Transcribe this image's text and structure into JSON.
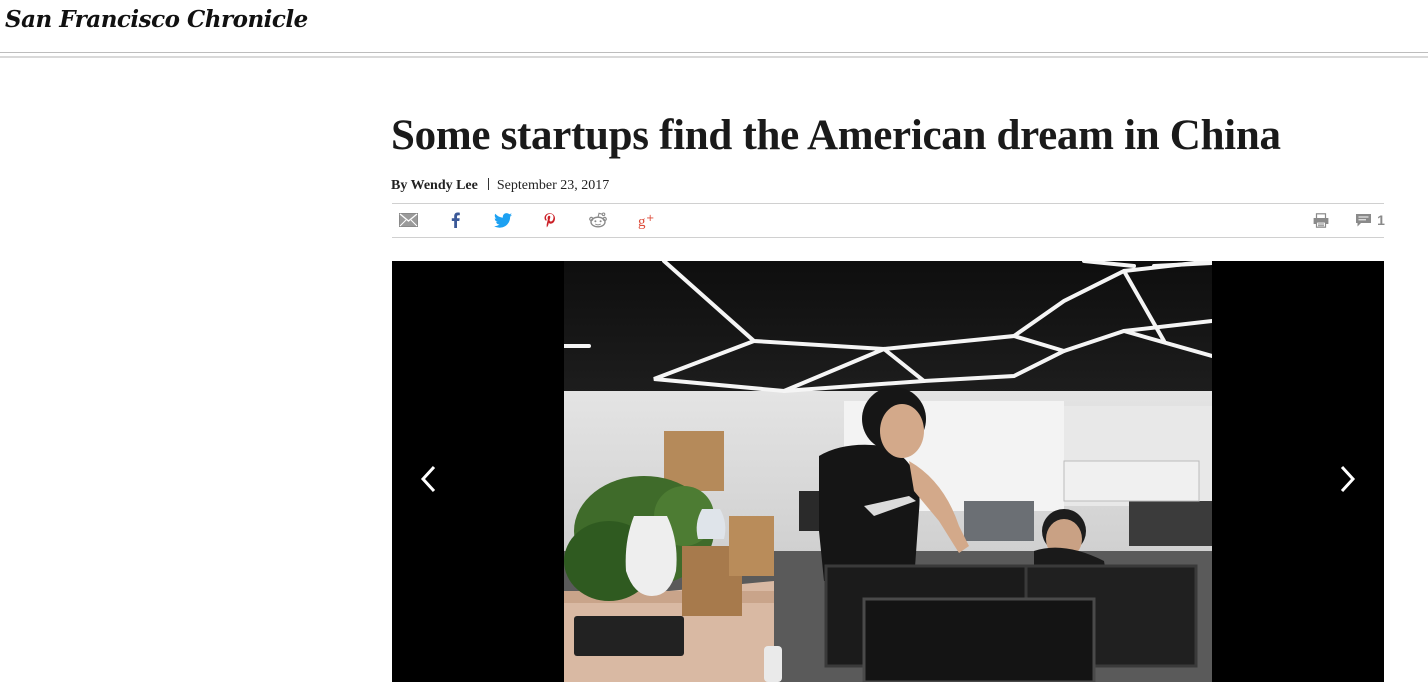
{
  "masthead": {
    "logo_text": "San Francisco Chronicle"
  },
  "article": {
    "headline": "Some startups find the American dream in China",
    "byline_author": "By Wendy Lee",
    "date": "September 23, 2017"
  },
  "share": {
    "icons": [
      "email-icon",
      "facebook-icon",
      "twitter-icon",
      "pinterest-icon",
      "reddit-icon",
      "google-plus-icon"
    ],
    "comment_count": "1"
  },
  "colors": {
    "facebook": "#3b5998",
    "twitter": "#1da1f2",
    "pinterest": "#cb2027",
    "google_plus": "#dd4b39",
    "icon_gray": "#8a8a8a"
  },
  "gallery": {
    "photo_description_icon": "office-photo",
    "prev_icon": "chevron-left-icon",
    "next_icon": "chevron-right-icon"
  }
}
